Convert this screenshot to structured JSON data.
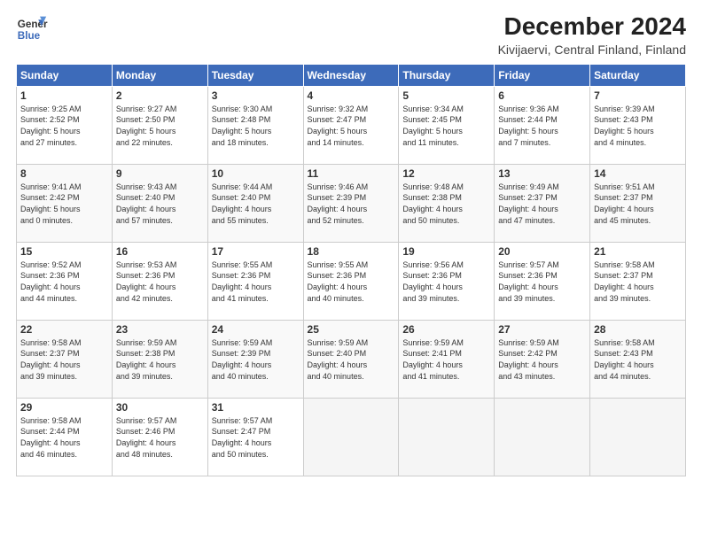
{
  "logo": {
    "line1": "General",
    "line2": "Blue"
  },
  "title": "December 2024",
  "location": "Kivijaervi, Central Finland, Finland",
  "headers": [
    "Sunday",
    "Monday",
    "Tuesday",
    "Wednesday",
    "Thursday",
    "Friday",
    "Saturday"
  ],
  "weeks": [
    [
      {
        "day": "1",
        "info": "Sunrise: 9:25 AM\nSunset: 2:52 PM\nDaylight: 5 hours\nand 27 minutes."
      },
      {
        "day": "2",
        "info": "Sunrise: 9:27 AM\nSunset: 2:50 PM\nDaylight: 5 hours\nand 22 minutes."
      },
      {
        "day": "3",
        "info": "Sunrise: 9:30 AM\nSunset: 2:48 PM\nDaylight: 5 hours\nand 18 minutes."
      },
      {
        "day": "4",
        "info": "Sunrise: 9:32 AM\nSunset: 2:47 PM\nDaylight: 5 hours\nand 14 minutes."
      },
      {
        "day": "5",
        "info": "Sunrise: 9:34 AM\nSunset: 2:45 PM\nDaylight: 5 hours\nand 11 minutes."
      },
      {
        "day": "6",
        "info": "Sunrise: 9:36 AM\nSunset: 2:44 PM\nDaylight: 5 hours\nand 7 minutes."
      },
      {
        "day": "7",
        "info": "Sunrise: 9:39 AM\nSunset: 2:43 PM\nDaylight: 5 hours\nand 4 minutes."
      }
    ],
    [
      {
        "day": "8",
        "info": "Sunrise: 9:41 AM\nSunset: 2:42 PM\nDaylight: 5 hours\nand 0 minutes."
      },
      {
        "day": "9",
        "info": "Sunrise: 9:43 AM\nSunset: 2:40 PM\nDaylight: 4 hours\nand 57 minutes."
      },
      {
        "day": "10",
        "info": "Sunrise: 9:44 AM\nSunset: 2:40 PM\nDaylight: 4 hours\nand 55 minutes."
      },
      {
        "day": "11",
        "info": "Sunrise: 9:46 AM\nSunset: 2:39 PM\nDaylight: 4 hours\nand 52 minutes."
      },
      {
        "day": "12",
        "info": "Sunrise: 9:48 AM\nSunset: 2:38 PM\nDaylight: 4 hours\nand 50 minutes."
      },
      {
        "day": "13",
        "info": "Sunrise: 9:49 AM\nSunset: 2:37 PM\nDaylight: 4 hours\nand 47 minutes."
      },
      {
        "day": "14",
        "info": "Sunrise: 9:51 AM\nSunset: 2:37 PM\nDaylight: 4 hours\nand 45 minutes."
      }
    ],
    [
      {
        "day": "15",
        "info": "Sunrise: 9:52 AM\nSunset: 2:36 PM\nDaylight: 4 hours\nand 44 minutes."
      },
      {
        "day": "16",
        "info": "Sunrise: 9:53 AM\nSunset: 2:36 PM\nDaylight: 4 hours\nand 42 minutes."
      },
      {
        "day": "17",
        "info": "Sunrise: 9:55 AM\nSunset: 2:36 PM\nDaylight: 4 hours\nand 41 minutes."
      },
      {
        "day": "18",
        "info": "Sunrise: 9:55 AM\nSunset: 2:36 PM\nDaylight: 4 hours\nand 40 minutes."
      },
      {
        "day": "19",
        "info": "Sunrise: 9:56 AM\nSunset: 2:36 PM\nDaylight: 4 hours\nand 39 minutes."
      },
      {
        "day": "20",
        "info": "Sunrise: 9:57 AM\nSunset: 2:36 PM\nDaylight: 4 hours\nand 39 minutes."
      },
      {
        "day": "21",
        "info": "Sunrise: 9:58 AM\nSunset: 2:37 PM\nDaylight: 4 hours\nand 39 minutes."
      }
    ],
    [
      {
        "day": "22",
        "info": "Sunrise: 9:58 AM\nSunset: 2:37 PM\nDaylight: 4 hours\nand 39 minutes."
      },
      {
        "day": "23",
        "info": "Sunrise: 9:59 AM\nSunset: 2:38 PM\nDaylight: 4 hours\nand 39 minutes."
      },
      {
        "day": "24",
        "info": "Sunrise: 9:59 AM\nSunset: 2:39 PM\nDaylight: 4 hours\nand 40 minutes."
      },
      {
        "day": "25",
        "info": "Sunrise: 9:59 AM\nSunset: 2:40 PM\nDaylight: 4 hours\nand 40 minutes."
      },
      {
        "day": "26",
        "info": "Sunrise: 9:59 AM\nSunset: 2:41 PM\nDaylight: 4 hours\nand 41 minutes."
      },
      {
        "day": "27",
        "info": "Sunrise: 9:59 AM\nSunset: 2:42 PM\nDaylight: 4 hours\nand 43 minutes."
      },
      {
        "day": "28",
        "info": "Sunrise: 9:58 AM\nSunset: 2:43 PM\nDaylight: 4 hours\nand 44 minutes."
      }
    ],
    [
      {
        "day": "29",
        "info": "Sunrise: 9:58 AM\nSunset: 2:44 PM\nDaylight: 4 hours\nand 46 minutes."
      },
      {
        "day": "30",
        "info": "Sunrise: 9:57 AM\nSunset: 2:46 PM\nDaylight: 4 hours\nand 48 minutes."
      },
      {
        "day": "31",
        "info": "Sunrise: 9:57 AM\nSunset: 2:47 PM\nDaylight: 4 hours\nand 50 minutes."
      },
      {
        "day": "",
        "info": ""
      },
      {
        "day": "",
        "info": ""
      },
      {
        "day": "",
        "info": ""
      },
      {
        "day": "",
        "info": ""
      }
    ]
  ]
}
